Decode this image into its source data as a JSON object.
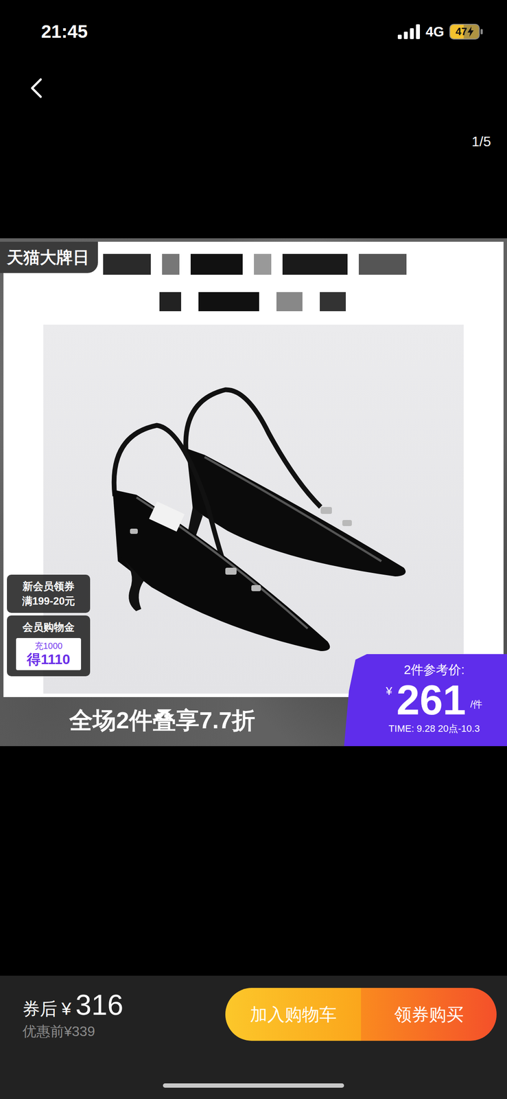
{
  "status_bar": {
    "time": "21:45",
    "network": "4G",
    "battery": "47",
    "battery_level": 0.47,
    "charging": true
  },
  "viewer": {
    "counter": "1/5"
  },
  "image": {
    "badge": "天猫大牌日",
    "coupon": {
      "line1": "新会员领券",
      "line2": "满199-20元"
    },
    "gold": {
      "title": "会员购物金",
      "line1": "充1000",
      "line2": "得1110"
    },
    "banner": "全场2件叠享7.7折",
    "price_tag": {
      "label": "2件参考价:",
      "currency": "¥",
      "price": "261",
      "unit": "/件",
      "time": "TIME: 9.28 20点-10.3"
    }
  },
  "bottom_bar": {
    "label": "券后",
    "currency": "¥",
    "price": "316",
    "original": "优惠前¥339",
    "buttons": [
      {
        "label": "加入购物车",
        "kind": "cart"
      },
      {
        "label": "领券购买",
        "kind": "buy"
      }
    ]
  }
}
